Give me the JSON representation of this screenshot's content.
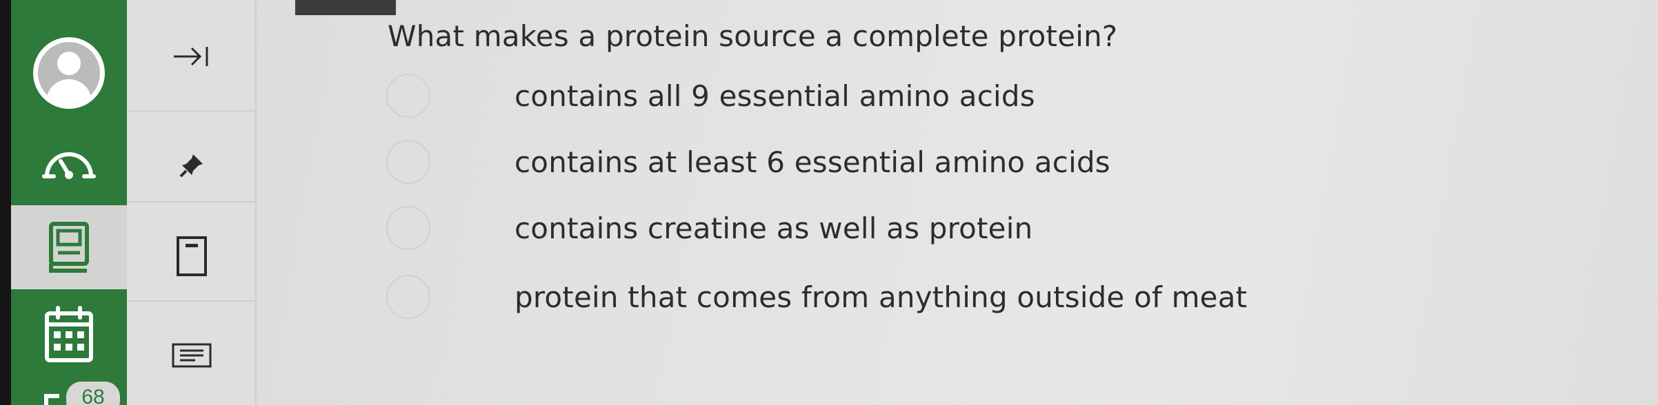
{
  "sidebar": {
    "items": [
      {
        "icon": "avatar-icon"
      },
      {
        "icon": "speedometer-icon"
      },
      {
        "icon": "notebook-icon"
      },
      {
        "icon": "calendar-icon"
      }
    ],
    "badge_count": "68"
  },
  "sub_panel": {
    "icons": [
      "expand-right-icon",
      "pin-icon",
      "page-icon",
      "notes-icon"
    ]
  },
  "question": {
    "text": "What makes a protein source a complete protein?",
    "options": [
      {
        "label": "contains all 9 essential amino acids"
      },
      {
        "label": "contains at least 6 essential amino acids"
      },
      {
        "label": "contains creatine as well as protein"
      },
      {
        "label": "protein that comes from anything outside of meat"
      }
    ]
  },
  "colors": {
    "rail_green": "#2d7a3a",
    "text": "#2c2c2c",
    "background": "#e2e3e1"
  }
}
